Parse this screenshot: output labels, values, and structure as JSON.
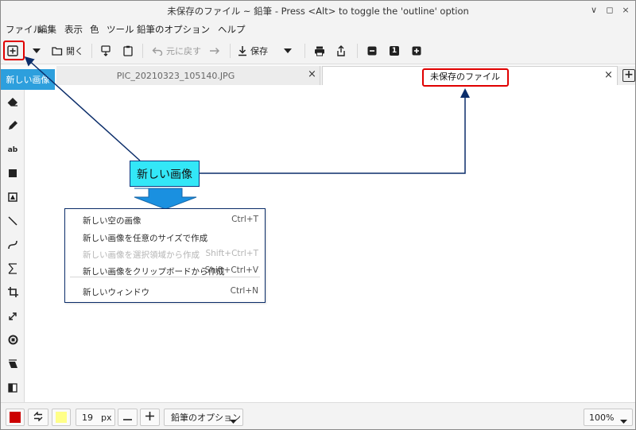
{
  "window": {
    "title": "未保存のファイル ~ 鉛筆 - Press <Alt> to toggle the 'outline' option",
    "controls": {
      "minimize": "∨",
      "maximize": "◻",
      "close": "×"
    }
  },
  "menubar": [
    "ファイル",
    "編集",
    "表示",
    "色",
    "ツール",
    "鉛筆のオプション",
    "ヘルプ"
  ],
  "toolbar": {
    "open_label": "開く",
    "undo_label": "元に戻す",
    "save_label": "保存",
    "zoom_reset_label": "1"
  },
  "tooltip": {
    "new_image": "新しい画像"
  },
  "tabs": [
    {
      "title": "PIC_20210323_105140.JPG",
      "close": "×"
    },
    {
      "title": "未保存のファイル",
      "close": "×"
    }
  ],
  "callout": {
    "text": "新しい画像"
  },
  "dropdown": {
    "items": [
      {
        "label": "新しい空の画像",
        "shortcut": "Ctrl+T",
        "enabled": true
      },
      {
        "label": "新しい画像を任意のサイズで作成",
        "shortcut": "",
        "enabled": true
      },
      {
        "label": "新しい画像を選択領域から作成",
        "shortcut": "Shift+Ctrl+T",
        "enabled": false
      },
      {
        "label": "新しい画像をクリップボードから作成",
        "shortcut": "Shift+Ctrl+V",
        "enabled": true
      },
      {
        "label": "新しいウィンドウ",
        "shortcut": "Ctrl+N",
        "enabled": true
      }
    ]
  },
  "bottombar": {
    "primary_color": "#cc0000",
    "secondary_color": "#ffff88",
    "size_value": "19",
    "size_unit": "px",
    "options_label": "鉛筆のオプション",
    "zoom_value": "100%"
  },
  "colors": {
    "highlight": "#e00000",
    "callout_fill": "#33e7f7",
    "callout_border": "#0b3a80",
    "accent": "#2d9fdd"
  }
}
